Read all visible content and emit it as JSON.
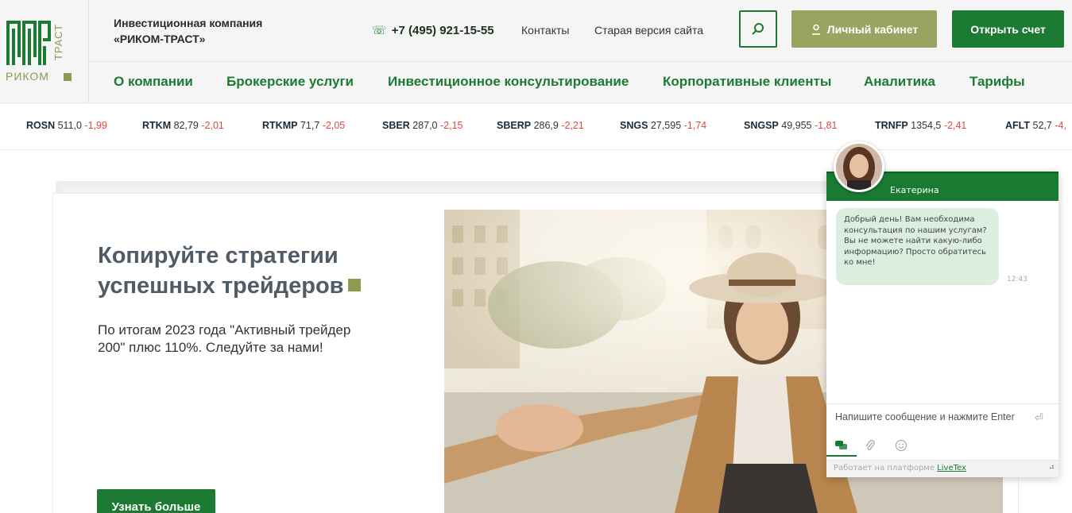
{
  "header": {
    "logo_text": "РИКОМ",
    "logo_vertical": "ТРАСТ",
    "company_line1": "Инвестиционная компания",
    "company_line2": "«РИКОМ-ТРАСТ»",
    "phone": "+7 (495) 921-15-55",
    "contacts": "Контакты",
    "old_site": "Старая версия сайта",
    "cabinet": "Личный кабинет",
    "open_account": "Открыть счет"
  },
  "nav": {
    "items": [
      "О компании",
      "Брокерские услуги",
      "Инвестиционное консультирование",
      "Корпоративные клиенты",
      "Аналитика",
      "Тарифы"
    ]
  },
  "ticker": [
    {
      "sym": "ROSN",
      "price": "511,0",
      "chg": "-1,99"
    },
    {
      "sym": "RTKM",
      "price": "82,79",
      "chg": "-2,01"
    },
    {
      "sym": "RTKMP",
      "price": "71,7",
      "chg": "-2,05"
    },
    {
      "sym": "SBER",
      "price": "287,0",
      "chg": "-2,15"
    },
    {
      "sym": "SBERP",
      "price": "286,9",
      "chg": "-2,21"
    },
    {
      "sym": "SNGS",
      "price": "27,595",
      "chg": "-1,74"
    },
    {
      "sym": "SNGSP",
      "price": "49,955",
      "chg": "-1,81"
    },
    {
      "sym": "TRNFP",
      "price": "1354,5",
      "chg": "-2,41"
    },
    {
      "sym": "AFLT",
      "price": "52,7",
      "chg": "-4,"
    }
  ],
  "promo": {
    "title_line1": "Копируйте стратегии",
    "title_line2": "успешных трейдеров",
    "text": "По итогам 2023 года \"Активный трейдер 200\" плюс 110%. Следуйте за нами!",
    "button": "Узнать больше"
  },
  "chat": {
    "agent_name": "Екатерина",
    "message": "Добрый день! Вам необходима консультация по нашим услугам? Вы не можете найти какую-либо информацию? Просто обратитесь ко мне!",
    "time": "12:43",
    "input_placeholder": "Напишите сообщение и нажмите Enter",
    "footer_prefix": "Работает на платформе ",
    "footer_link": "LiveTex"
  },
  "colors": {
    "brand_green": "#1c7a33",
    "olive": "#9aa35f",
    "negative": "#e04848"
  }
}
